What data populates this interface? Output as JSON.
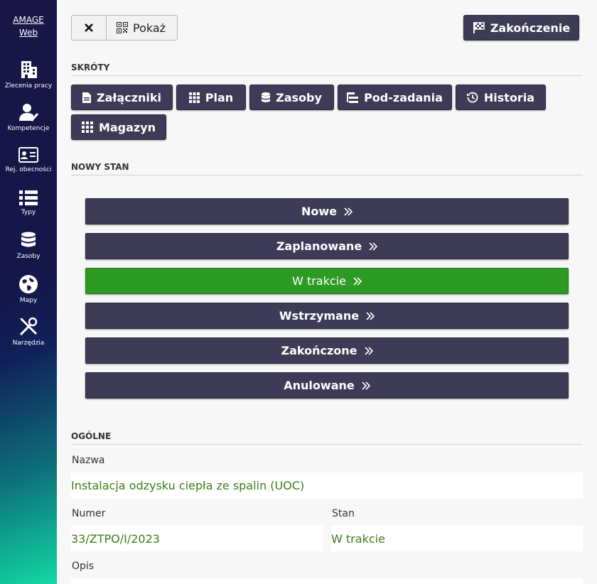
{
  "sidebar": {
    "brand_line1": "AMAGE",
    "brand_line2": "Web",
    "items": [
      {
        "label": "Zlecenia pracy",
        "icon": "building-icon"
      },
      {
        "label": "Kompetencje",
        "icon": "user-check-icon"
      },
      {
        "label": "Rej. obecności",
        "icon": "id-card-icon"
      },
      {
        "label": "Typy",
        "icon": "list-icon"
      },
      {
        "label": "Zasoby",
        "icon": "database-icon"
      },
      {
        "label": "Mapy",
        "icon": "globe-icon"
      },
      {
        "label": "Narzędzia",
        "icon": "tools-icon"
      }
    ]
  },
  "toolbar": {
    "close_icon": "close-icon",
    "show_label": "Pokaż",
    "finish_label": "Zakończenie"
  },
  "shortcuts": {
    "title": "SKRÓTY",
    "items": [
      {
        "label": "Załączniki",
        "icon": "file-icon"
      },
      {
        "label": "Plan",
        "icon": "grid-icon"
      },
      {
        "label": "Zasoby",
        "icon": "database-icon"
      },
      {
        "label": "Pod-zadania",
        "icon": "subtasks-icon"
      },
      {
        "label": "Historia",
        "icon": "history-icon"
      },
      {
        "label": "Magazyn",
        "icon": "grid-large-icon"
      }
    ]
  },
  "new_state": {
    "title": "NOWY STAN",
    "states": [
      {
        "label": "Nowe",
        "active": false
      },
      {
        "label": "Zaplanowane",
        "active": false
      },
      {
        "label": "W trakcie",
        "active": true
      },
      {
        "label": "Wstrzymane",
        "active": false
      },
      {
        "label": "Zakończone",
        "active": false
      },
      {
        "label": "Anulowane",
        "active": false
      }
    ]
  },
  "general": {
    "title": "OGÓLNE",
    "name_label": "Nazwa",
    "name_value": "Instalacja odzysku ciepła ze spalin (UOC)",
    "number_label": "Numer",
    "number_value": "33/ZTPO/I/2023",
    "state_label": "Stan",
    "state_value": "W trakcie",
    "desc_label": "Opis"
  },
  "colors": {
    "primary_button": "#3d3b56",
    "active_state": "#2d9a24",
    "value_text": "#3a7d17"
  }
}
